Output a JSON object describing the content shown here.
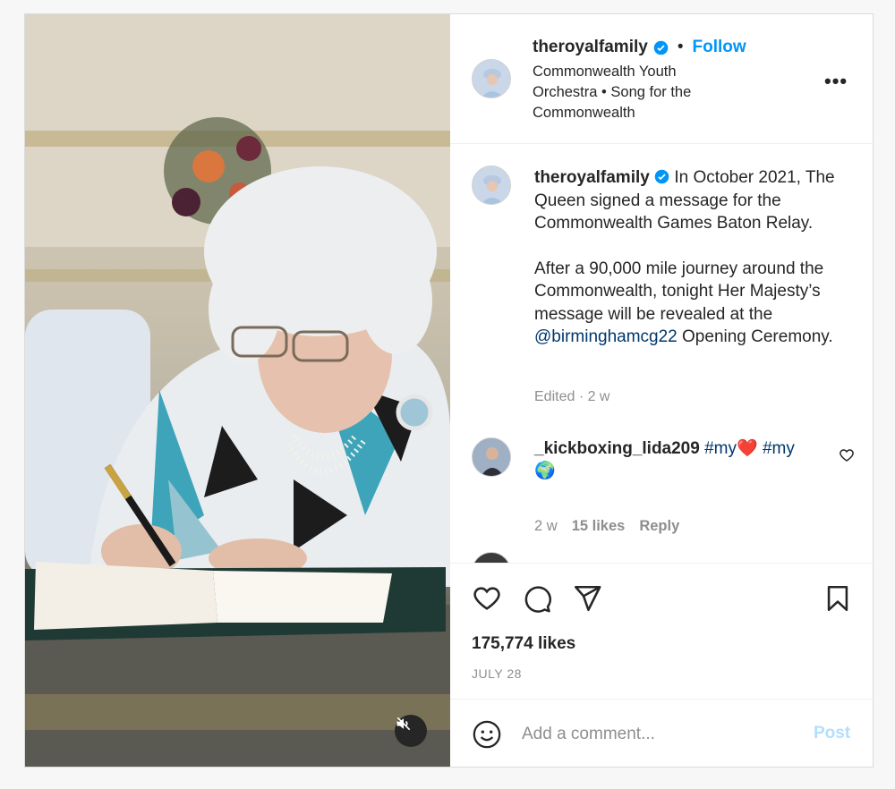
{
  "post": {
    "author": "theroyalfamily",
    "follow_label": "Follow",
    "separator": "•",
    "location_line1": "Commonwealth Youth",
    "location_line2": "Orchestra • Song for the",
    "location_line3": "Commonwealth",
    "more_label": "•••"
  },
  "caption": {
    "author": "theroyalfamily",
    "text_part1": "In October 2021, The Queen signed a message for the Commonwealth Games Baton Relay.",
    "text_part2a": "After a 90,000 mile journey around the Commonwealth, tonight Her Majesty’s message will be revealed at the",
    "mention": "@birminghamcg22",
    "text_part2b": "Opening Ceremony.",
    "meta": "Edited · 2 w"
  },
  "comment": {
    "author": "_kickboxing_lida209",
    "tag1": "#my",
    "heart_emoji": "❤️",
    "tag2": "#my",
    "globe_emoji": "🌍",
    "age": "2 w",
    "likes": "15 likes",
    "reply_label": "Reply"
  },
  "actions": {
    "icons": [
      "heart-icon",
      "comment-icon",
      "share-icon",
      "bookmark-icon"
    ],
    "likes_text": "175,774 likes",
    "date": "JULY 28"
  },
  "compose": {
    "placeholder": "Add a comment...",
    "post_label": "Post",
    "icon": "emoji-icon"
  },
  "media": {
    "mute_icon": "speaker-muted-icon"
  },
  "colors": {
    "accent": "#0095f6",
    "link": "#00376b",
    "muted": "#8e8e8e",
    "post_disabled": "#b2dffc"
  }
}
